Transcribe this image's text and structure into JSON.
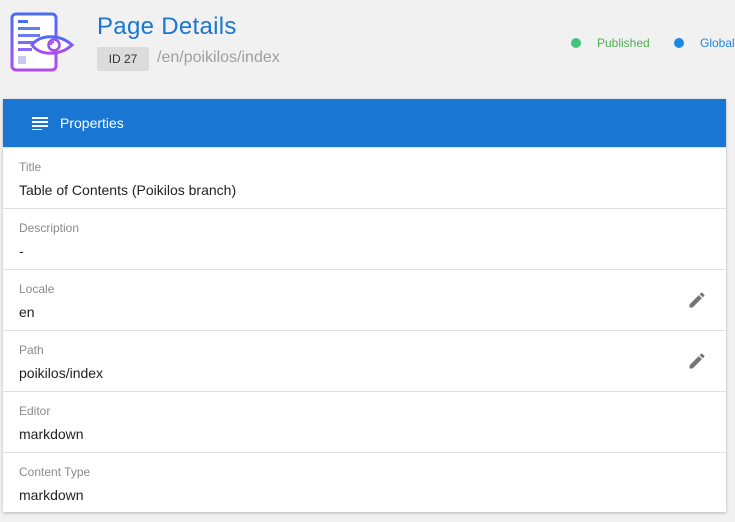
{
  "header": {
    "title": "Page Details",
    "id_chip": "ID 27",
    "path": "/en/poikilos/index",
    "icon": "page-preview-icon",
    "status": [
      {
        "label": "Published",
        "color": "#4caf50",
        "dot": "#42c57a"
      },
      {
        "label": "Global",
        "color": "#1e88e5",
        "dot": "#1e88e5"
      }
    ]
  },
  "card": {
    "header_label": "Properties",
    "header_icon": "menu-icon",
    "accent": "#1976d2",
    "properties": [
      {
        "label": "Title",
        "value": "Table of Contents (Poikilos branch)",
        "editable": false
      },
      {
        "label": "Description",
        "value": "-",
        "editable": false
      },
      {
        "label": "Locale",
        "value": "en",
        "editable": true,
        "icon": "pencil-icon"
      },
      {
        "label": "Path",
        "value": "poikilos/index",
        "editable": true,
        "icon": "pencil-icon"
      },
      {
        "label": "Editor",
        "value": "markdown",
        "editable": false
      },
      {
        "label": "Content Type",
        "value": "markdown",
        "editable": false
      }
    ]
  }
}
